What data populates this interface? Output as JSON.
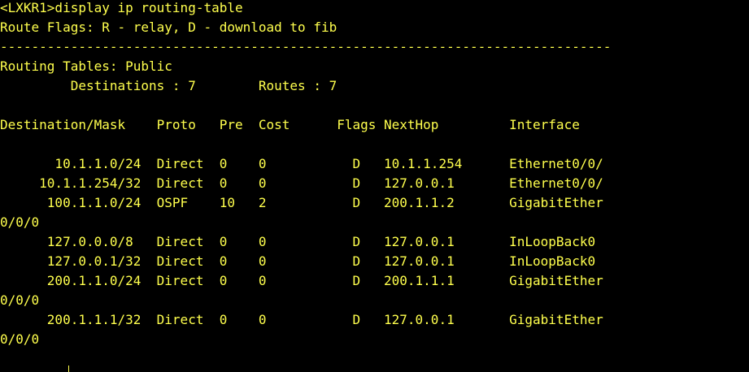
{
  "terminal": {
    "lines": [
      "<LXKR1>display ip routing-table",
      "Route Flags: R - relay, D - download to fib",
      "------------------------------------------------------------------------------",
      "Routing Tables: Public",
      "         Destinations : 7        Routes : 7",
      "",
      "Destination/Mask    Proto   Pre  Cost      Flags NextHop         Interface",
      "",
      "       10.1.1.0/24  Direct  0    0           D   10.1.1.254      Ethernet0/0/",
      "     10.1.1.254/32  Direct  0    0           D   127.0.0.1       Ethernet0/0/",
      "      100.1.1.0/24  OSPF    10   2           D   200.1.1.2       GigabitEther",
      "0/0/0",
      "      127.0.0.0/8   Direct  0    0           D   127.0.0.1       InLoopBack0",
      "      127.0.0.1/32  Direct  0    0           D   127.0.0.1       InLoopBack0",
      "      200.1.1.0/24  Direct  0    0           D   200.1.1.1       GigabitEther",
      "0/0/0",
      "      200.1.1.1/32  Direct  0    0           D   127.0.0.1       GigabitEther",
      "0/0/0"
    ]
  },
  "colors": {
    "background": "#000000",
    "text": "#ffff4d"
  }
}
